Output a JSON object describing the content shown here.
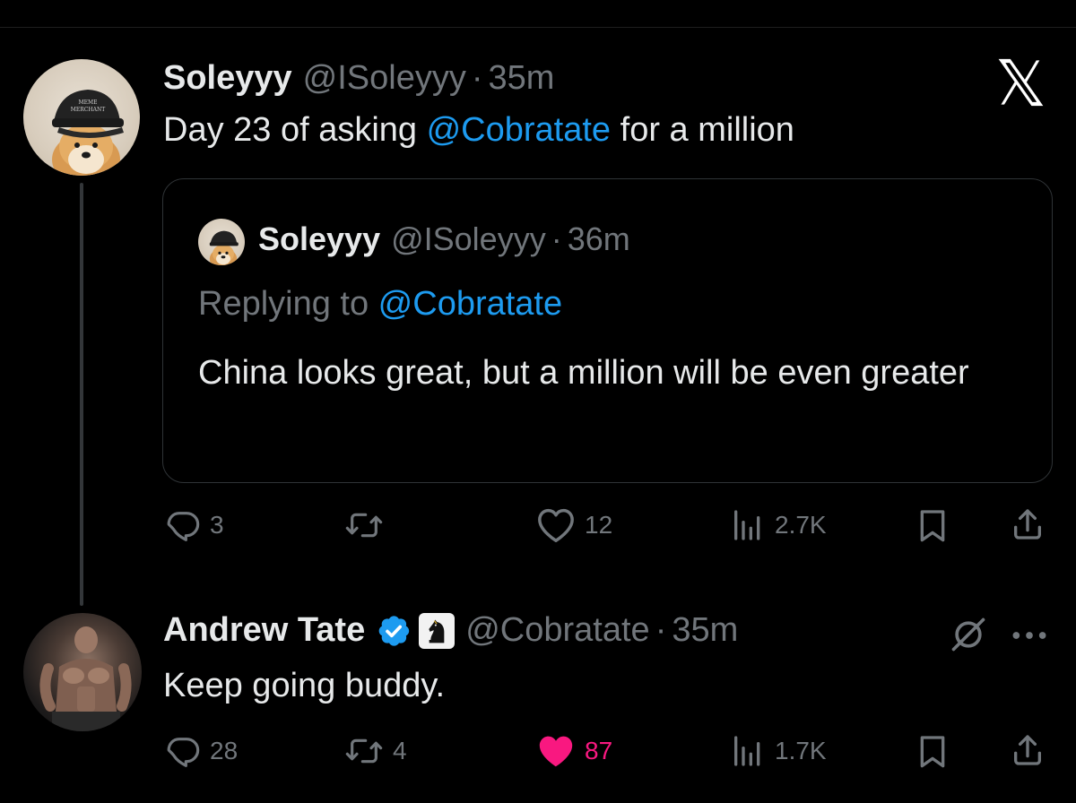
{
  "main_tweet": {
    "display_name": "Soleyyy",
    "handle": "@ISoleyyy",
    "separator": "·",
    "time": "35m",
    "text_before": "Day 23 of asking ",
    "text_mention": "@Cobratate",
    "text_after": " for a million",
    "avatar_cap_text": "MEME MERCHANT",
    "actions": {
      "replies": "3",
      "retweets": "",
      "likes": "12",
      "views": "2.7K"
    }
  },
  "quoted_tweet": {
    "display_name": "Soleyyy",
    "handle": "@ISoleyyy",
    "separator": "·",
    "time": "36m",
    "replying_prefix": "Replying to ",
    "replying_mention": "@Cobratate",
    "text": "China looks great, but a million will be even greater"
  },
  "reply_tweet": {
    "display_name": "Andrew Tate",
    "handle": "@Cobratate",
    "separator": "·",
    "time": "35m",
    "text": "Keep going buddy.",
    "actions": {
      "replies": "28",
      "retweets": "4",
      "likes": "87",
      "views": "1.7K"
    }
  },
  "colors": {
    "background": "#000000",
    "text": "#e7e9ea",
    "muted": "#71767b",
    "accent": "#1d9bf0",
    "like": "#f91880",
    "verified": "#1d9bf0"
  },
  "icons": [
    "x-logo-icon",
    "reply-icon",
    "retweet-icon",
    "like-icon",
    "views-icon",
    "bookmark-icon",
    "share-icon",
    "verified-badge-icon",
    "chess-knight-icon",
    "grok-icon",
    "more-icon"
  ]
}
